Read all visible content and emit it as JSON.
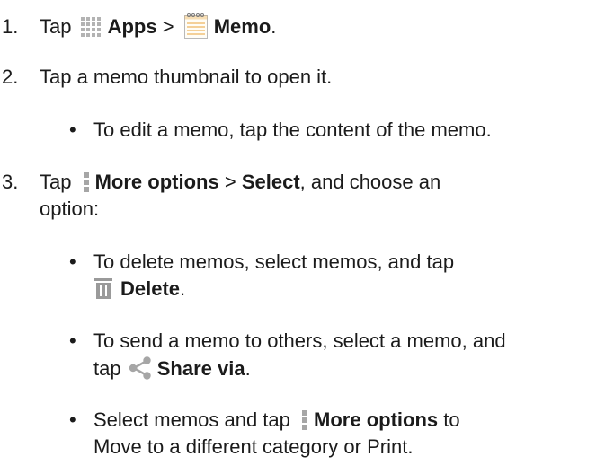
{
  "steps": [
    {
      "num": "1.",
      "pre": "Tap",
      "apps": "Apps",
      "sep": ">",
      "memo": "Memo",
      "end": "."
    },
    {
      "num": "2.",
      "text": "Tap a memo thumbnail to open it."
    },
    {
      "num": "3.",
      "pre": "Tap",
      "more": "More options",
      "sep": ">",
      "select": "Select",
      "post": ", and choose an",
      "cont": "option:"
    }
  ],
  "bullets": {
    "edit": "To edit a memo, tap the content of the memo.",
    "delete_line1": "To delete memos, select memos, and tap",
    "delete_label": "Delete",
    "delete_end": ".",
    "share_line1": "To send a memo to others, select a memo, and",
    "share_pre": "tap",
    "share_label": "Share via",
    "share_end": ".",
    "more_pre": "Select memos and tap",
    "more_label": "More options",
    "more_post": "to",
    "more_line2": "Move to a different category or Print."
  },
  "icons": {
    "apps": "apps-grid-icon",
    "memo": "memo-notepad-icon",
    "more": "more-options-icon",
    "delete": "trash-icon",
    "share": "share-icon"
  },
  "colors": {
    "text": "#1b1b1b",
    "icon_gray": "#a6a6a6",
    "delete_gray": "#9a9a9a",
    "memo_accent": "#e8a23a"
  }
}
